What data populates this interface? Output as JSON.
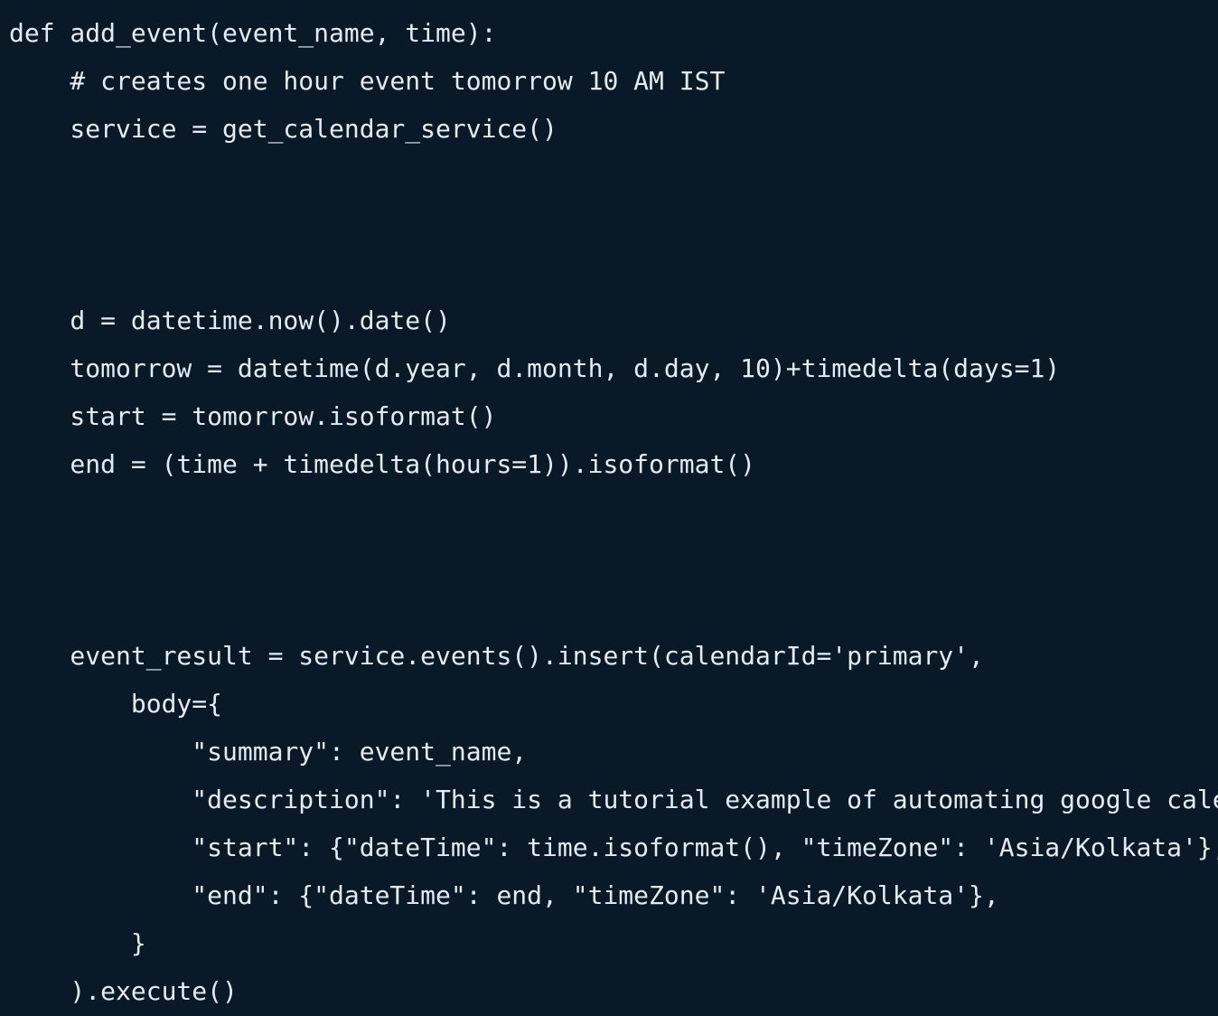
{
  "editor": {
    "background_color": "#0a1928",
    "text_color": "#e4ebf2",
    "font_size_px": 28,
    "line_height_px": 53,
    "language": "python"
  },
  "code": {
    "lines": [
      "def add_event(event_name, time):",
      "    # creates one hour event tomorrow 10 AM IST",
      "    service = get_calendar_service()",
      "",
      "",
      "",
      "    d = datetime.now().date()",
      "    tomorrow = datetime(d.year, d.month, d.day, 10)+timedelta(days=1)",
      "    start = tomorrow.isoformat()",
      "    end = (time + timedelta(hours=1)).isoformat()",
      "",
      "",
      "",
      "    event_result = service.events().insert(calendarId='primary',",
      "        body={",
      "            \"summary\": event_name,",
      "            \"description\": 'This is a tutorial example of automating google calendar with python',",
      "            \"start\": {\"dateTime\": time.isoformat(), \"timeZone\": 'Asia/Kolkata'},",
      "            \"end\": {\"dateTime\": end, \"timeZone\": 'Asia/Kolkata'},",
      "        }",
      "    ).execute()"
    ]
  }
}
